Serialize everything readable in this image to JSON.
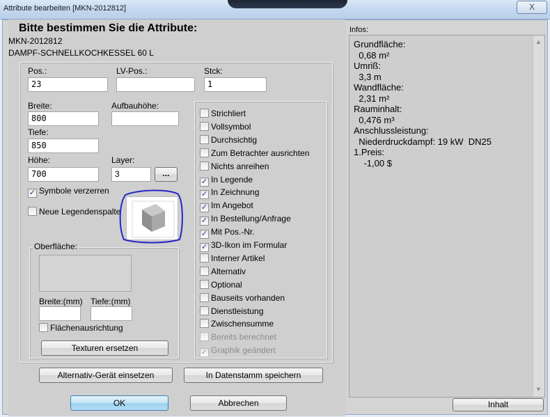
{
  "window": {
    "title": "Attribute bearbeiten [MKN-2012812]",
    "close_label": "X"
  },
  "header": {
    "heading": "Bitte bestimmen Sie die Attribute:",
    "article_no": "MKN-2012812",
    "article_name": "DAMPF-SCHNELLKOCHKESSEL 60 L"
  },
  "fields": {
    "pos": {
      "label": "Pos.:",
      "value": "23"
    },
    "lv_pos": {
      "label": "LV-Pos.:",
      "value": ""
    },
    "stck": {
      "label": "Stck:",
      "value": "1"
    },
    "breite": {
      "label": "Breite:",
      "value": "800"
    },
    "aufbauhoehe": {
      "label": "Aufbauhöhe:",
      "value": ""
    },
    "tiefe": {
      "label": "Tiefe:",
      "value": "850"
    },
    "hoehe": {
      "label": "Höhe:",
      "value": "700"
    },
    "layer": {
      "label": "Layer:",
      "value": "3"
    },
    "layer_button": "..."
  },
  "options_left": {
    "symbole_verzerren": {
      "label": "Symbole verzerren",
      "checked": true
    },
    "neue_legendenspalte": {
      "label": "Neue Legendenspalte",
      "checked": false
    }
  },
  "oberflaeche": {
    "title": "Oberfläche:",
    "breite_label": "Breite:(mm)",
    "breite_value": "",
    "tiefe_label": "Tiefe:(mm)",
    "tiefe_value": "",
    "flaechenausrichtung": {
      "label": "Flächenausrichtung",
      "checked": false
    },
    "texturen_button": "Texturen ersetzen"
  },
  "checkboxes": [
    {
      "label": "Strichliert",
      "checked": false,
      "disabled": false
    },
    {
      "label": "Vollsymbol",
      "checked": false,
      "disabled": false
    },
    {
      "label": "Durchsichtig",
      "checked": false,
      "disabled": false
    },
    {
      "label": "Zum Betrachter ausrichten",
      "checked": false,
      "disabled": false
    },
    {
      "label": "Nichts anreihen",
      "checked": false,
      "disabled": false
    },
    {
      "label": "In Legende",
      "checked": true,
      "disabled": false
    },
    {
      "label": "In Zeichnung",
      "checked": true,
      "disabled": false
    },
    {
      "label": "Im Angebot",
      "checked": true,
      "disabled": false
    },
    {
      "label": "In Bestellung/Anfrage",
      "checked": true,
      "disabled": false
    },
    {
      "label": "Mit Pos.-Nr.",
      "checked": true,
      "disabled": false
    },
    {
      "label": "3D-Ikon im Formular",
      "checked": true,
      "disabled": false
    },
    {
      "label": "Interner Artikel",
      "checked": false,
      "disabled": false
    },
    {
      "label": "Alternativ",
      "checked": false,
      "disabled": false
    },
    {
      "label": "Optional",
      "checked": false,
      "disabled": false
    },
    {
      "label": "Bauseits vorhanden",
      "checked": false,
      "disabled": false
    },
    {
      "label": "Dienstleistung",
      "checked": false,
      "disabled": false
    },
    {
      "label": "Zwischensumme",
      "checked": false,
      "disabled": false
    },
    {
      "label": "Bereits berechnet",
      "checked": false,
      "disabled": true
    },
    {
      "label": "Graphik geändert",
      "checked": true,
      "disabled": true
    }
  ],
  "buttons": {
    "alternativ": "Alternativ-Gerät einsetzen",
    "datenstamm": "In Datenstamm speichern",
    "ok": "OK",
    "abbrechen": "Abbrechen",
    "inhalt": "Inhalt"
  },
  "info": {
    "title": "Infos:",
    "lines": [
      "Grundfläche:",
      "  0,68 m²",
      "Umriß:",
      "  3,3 m",
      "Wandfläche:",
      "  2,31 m²",
      "Rauminhalt:",
      "  0,476 m³",
      "Anschlussleistung:",
      "  Niederdruckdampf: 19 kW  DN25",
      "1.Preis:",
      "    -1,00 $"
    ]
  },
  "colors": {
    "annotation_circle": "#2626c8",
    "check_mark": "#2a3a8a"
  }
}
